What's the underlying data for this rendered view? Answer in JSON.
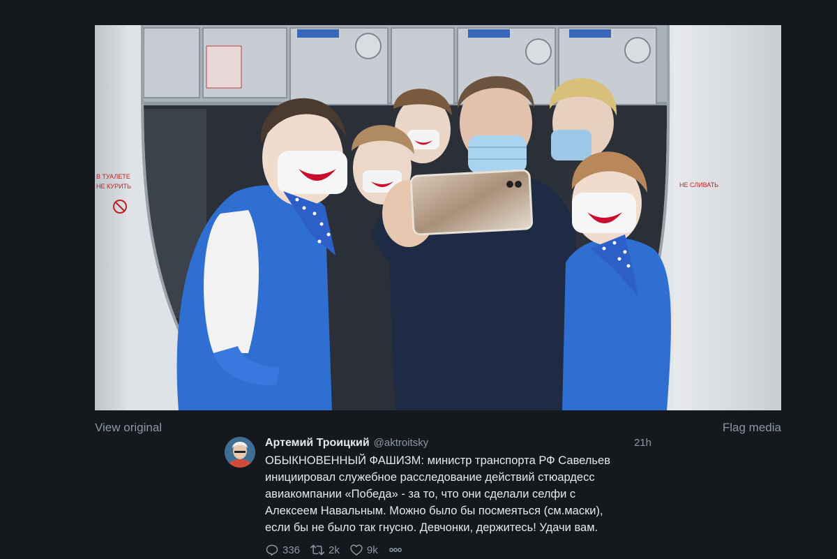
{
  "media": {
    "photo_alt": "",
    "view_original_label": "View original",
    "flag_media_label": "Flag media",
    "sign_text_1": "В ТУАЛЕТЕ",
    "sign_text_2": "НЕ КУРИТЬ",
    "sign_text_3": "НЕ СЛИВАТЬ"
  },
  "tweet": {
    "display_name": "Артемий Троицкий",
    "handle": "@aktroitsky",
    "time": "21h",
    "text": "ОБЫКНОВЕННЫЙ ФАШИЗМ: министр транспорта РФ Савельев\nинициировал служебное расследование действий стюардесс\nавиакомпании «Победа» - за то, что они сделали селфи с\nАлексеем Навальным. Можно было бы посмеяться (см.маски),\nесли бы не было так гнусно. Девчонки, держитесь! Удачи вам.",
    "actions": {
      "replies": "336",
      "retweets": "2k",
      "likes": "9k"
    }
  },
  "icons": {
    "reply": "reply-icon",
    "retweet": "retweet-icon",
    "like": "heart-icon",
    "more": "more-dots-icon"
  },
  "colors": {
    "background": "#15181c",
    "text_primary": "#e7e9ea",
    "text_secondary": "#8b98a5",
    "uniform_blue": "#2f6fd1",
    "mask_red": "#c8102e"
  }
}
